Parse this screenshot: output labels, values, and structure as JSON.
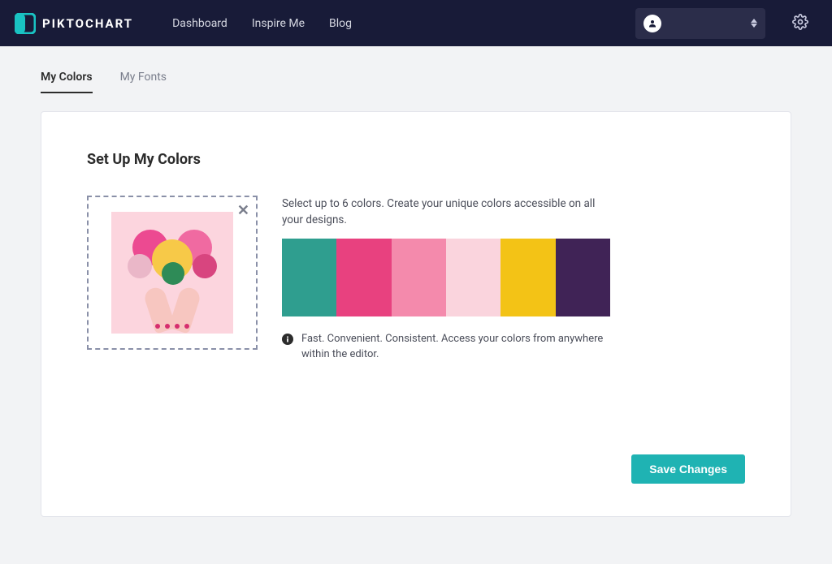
{
  "brand": {
    "name": "PIKTOCHART"
  },
  "nav": {
    "items": [
      {
        "label": "Dashboard"
      },
      {
        "label": "Inspire Me"
      },
      {
        "label": "Blog"
      }
    ]
  },
  "tabs": {
    "items": [
      {
        "label": "My Colors",
        "active": true
      },
      {
        "label": "My Fonts",
        "active": false
      }
    ]
  },
  "panel": {
    "title": "Set Up My Colors",
    "instructions": "Select up to 6 colors. Create your unique colors accessible on all your designs.",
    "hint": "Fast. Convenient. Consistent. Access your colors from anywhere within the editor.",
    "swatches": [
      {
        "hex": "#2f9e8f"
      },
      {
        "hex": "#e8417f"
      },
      {
        "hex": "#f48aac"
      },
      {
        "hex": "#fad4dd"
      },
      {
        "hex": "#f3c316"
      },
      {
        "hex": "#402356"
      }
    ],
    "save_label": "Save Changes"
  }
}
